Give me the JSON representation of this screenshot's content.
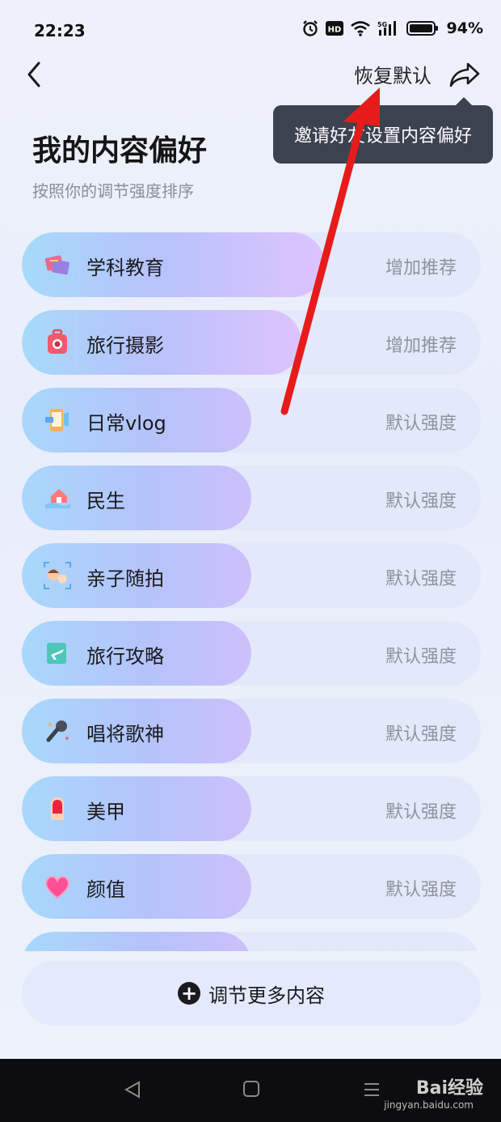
{
  "status_bar": {
    "time": "22:23",
    "network": "5G",
    "hd": "HD",
    "battery": "94%"
  },
  "nav": {
    "back_icon": "chevron-left-icon",
    "restore_label": "恢复默认",
    "share_icon": "share-arrow-icon"
  },
  "tooltip": {
    "text": "邀请好友设置内容偏好"
  },
  "page": {
    "title": "我的内容偏好",
    "subtitle": "按照你的调节强度排序"
  },
  "preferences": [
    {
      "label": "学科教育",
      "status": "增加推荐",
      "icon": "education-books-icon",
      "level": 0.66
    },
    {
      "label": "旅行摄影",
      "status": "增加推荐",
      "icon": "camera-luggage-icon",
      "level": 0.61
    },
    {
      "label": "日常vlog",
      "status": "默认强度",
      "icon": "clapper-phone-icon",
      "level": 0.5
    },
    {
      "label": "民生",
      "status": "默认强度",
      "icon": "house-hand-icon",
      "level": 0.5
    },
    {
      "label": "亲子随拍",
      "status": "默认强度",
      "icon": "parent-child-icon",
      "level": 0.5
    },
    {
      "label": "旅行攻略",
      "status": "默认强度",
      "icon": "plane-guide-icon",
      "level": 0.5
    },
    {
      "label": "唱将歌神",
      "status": "默认强度",
      "icon": "microphone-icon",
      "level": 0.5
    },
    {
      "label": "美甲",
      "status": "默认强度",
      "icon": "nail-polish-icon",
      "level": 0.5
    },
    {
      "label": "颜值",
      "status": "默认强度",
      "icon": "heart-icon",
      "level": 0.5
    },
    {
      "label": "",
      "status": "",
      "icon": "",
      "level": 0.5
    }
  ],
  "more_button": {
    "label": "调节更多内容",
    "icon": "plus-circle-icon"
  },
  "system_nav": {
    "back_icon": "triangle-back-icon",
    "home_icon": "square-home-icon",
    "menu_icon": "menu-lines-icon"
  },
  "watermark": {
    "brand": "Bai经验",
    "url": "jingyan.baidu.com"
  },
  "colors": {
    "bar_fill_start": "#a8d8fb",
    "bar_fill_end": "#cdc0fb",
    "row_track": "#e3e9fa",
    "tooltip_bg": "#3d4250",
    "annotation_arrow": "#e81b1b"
  }
}
